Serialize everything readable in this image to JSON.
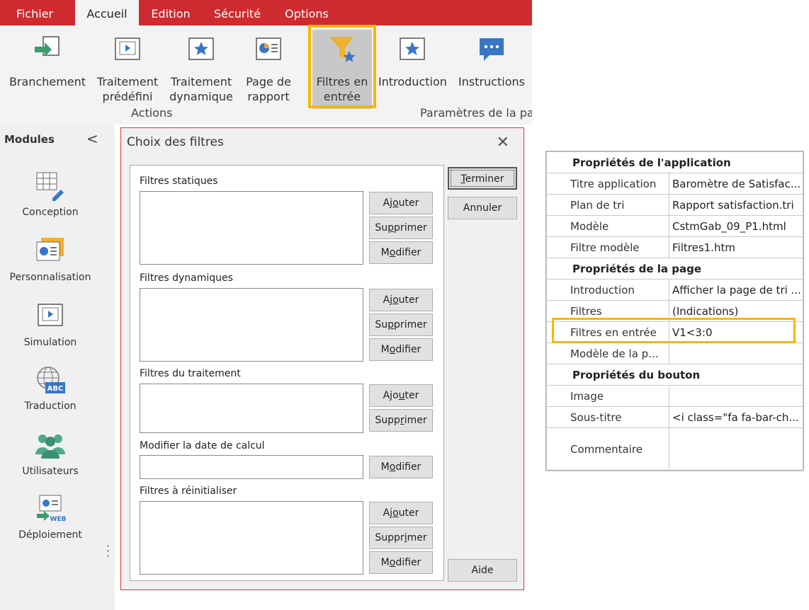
{
  "ribbon": {
    "tabs": [
      "Fichier",
      "Accueil",
      "Edition",
      "Sécurité",
      "Options"
    ],
    "active_tab": "Accueil",
    "buttons": {
      "branchement": "Branchement",
      "traitement_predefini_1": "Traitement",
      "traitement_predefini_2": "prédéfini",
      "traitement_dynamique_1": "Traitement",
      "traitement_dynamique_2": "dynamique",
      "page_rapport_1": "Page de",
      "page_rapport_2": "rapport",
      "filtres_entree_1": "Filtres en",
      "filtres_entree_2": "entrée",
      "introduction": "Introduction",
      "instructions": "Instructions"
    },
    "groups": {
      "actions": "Actions",
      "parametres": "Paramètres de la page"
    },
    "highlight_color": "#f5b800",
    "accent_color": "#cd2b30"
  },
  "modules": {
    "title": "Modules",
    "collapse": "<",
    "items": [
      "Conception",
      "Personnalisation",
      "Simulation",
      "Traduction",
      "Utilisateurs",
      "Déploiement"
    ]
  },
  "dialog": {
    "title": "Choix des filtres",
    "close": "✕",
    "sections": {
      "statiques": "Filtres statiques",
      "dynamiques": "Filtres dynamiques",
      "traitement": "Filtres du traitement",
      "date": "Modifier la date de calcul",
      "reinit": "Filtres à réinitialiser"
    },
    "buttons": {
      "ajouter": [
        "Aj",
        "o",
        "uter"
      ],
      "supprimer": [
        "Su",
        "p",
        "primer"
      ],
      "modifier": [
        "M",
        "o",
        "difier"
      ],
      "ajouter_traitement": [
        "Ajo",
        "u",
        "ter"
      ],
      "supprimer_traitement": [
        "Supp",
        "r",
        "imer"
      ],
      "supprimer_reinit": [
        "Suppr",
        "i",
        "mer"
      ],
      "terminer": [
        "",
        "T",
        "erminer"
      ],
      "annuler": "Annuler",
      "aide": "Aide"
    }
  },
  "properties": {
    "sections": [
      "Propriétés de l'application",
      "Propriétés de la page",
      "Propriétés du bouton"
    ],
    "app_rows": [
      {
        "key": "Titre application",
        "value": "Baromètre de Satisfac..."
      },
      {
        "key": "Plan de tri",
        "value": "Rapport satisfaction.tri"
      },
      {
        "key": "Modèle",
        "value": "CstmGab_09_P1.html"
      },
      {
        "key": "Filtre modèle",
        "value": "Filtres1.htm"
      }
    ],
    "page_rows": [
      {
        "key": "Introduction",
        "value": "Afficher la page de tri ..."
      },
      {
        "key": "Filtres",
        "value": "(Indications)"
      },
      {
        "key": "Filtres en entrée",
        "value": "V1<3:0"
      },
      {
        "key": "Modèle de la p...",
        "value": ""
      }
    ],
    "button_rows": [
      {
        "key": "Image",
        "value": ""
      },
      {
        "key": "Sous-titre",
        "value": "<i class=\"fa fa-bar-ch..."
      },
      {
        "key": "Commentaire",
        "value": ""
      }
    ]
  }
}
